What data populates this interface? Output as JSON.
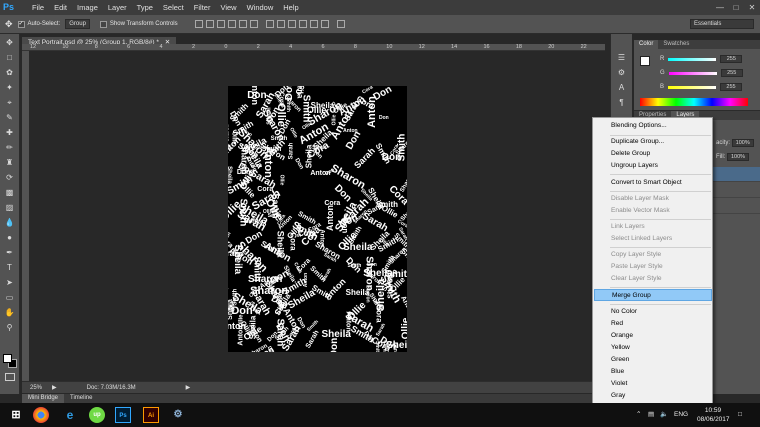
{
  "app": {
    "logo": "Ps",
    "menu": [
      "File",
      "Edit",
      "Image",
      "Layer",
      "Type",
      "Select",
      "Filter",
      "View",
      "Window",
      "Help"
    ]
  },
  "options": {
    "auto_select": "Auto-Select:",
    "auto_select_target": "Group",
    "show_transform": "Show Transform Controls",
    "workspace": "Essentials"
  },
  "document": {
    "tab_title": "Text Portrait.psd @ 25% (Group 1, RGB/8#) *",
    "ruler_ticks": [
      "12",
      "10",
      "8",
      "6",
      "4",
      "2",
      "0",
      "2",
      "4",
      "6",
      "8",
      "10",
      "12",
      "14",
      "16",
      "18",
      "20",
      "22"
    ],
    "zoom": "25%",
    "doc_size": "Doc: 7.03M/16.3M",
    "words": [
      "Cora",
      "Don",
      "Anton",
      "Sarah",
      "Ollie",
      "Sharon",
      "Sheila",
      "Smith"
    ]
  },
  "bottom_tabs": [
    "Mini Bridge",
    "Timeline"
  ],
  "color_panel": {
    "tabs": [
      "Color",
      "Swatches"
    ],
    "r_label": "R",
    "r_value": "255",
    "g_label": "G",
    "g_value": "255",
    "b_label": "B",
    "b_value": "255"
  },
  "layers_panel": {
    "tabs": [
      "Properties",
      "Layers"
    ],
    "opacity_label": "acity:",
    "opacity_value": "100%",
    "fill_label": "Fill:",
    "fill_value": "100%"
  },
  "context_menu": {
    "items": [
      {
        "label": "Blending Options...",
        "disabled": false
      },
      {
        "label": "Duplicate Group...",
        "disabled": false
      },
      {
        "label": "Delete Group",
        "disabled": false
      },
      {
        "label": "Ungroup Layers",
        "disabled": false
      },
      {
        "label": "Convert to Smart Object",
        "disabled": false
      },
      {
        "label": "Disable Layer Mask",
        "disabled": true
      },
      {
        "label": "Enable Vector Mask",
        "disabled": true
      },
      {
        "label": "Link Layers",
        "disabled": true
      },
      {
        "label": "Select Linked Layers",
        "disabled": true
      },
      {
        "label": "Copy Layer Style",
        "disabled": true
      },
      {
        "label": "Paste Layer Style",
        "disabled": true
      },
      {
        "label": "Clear Layer Style",
        "disabled": true
      },
      {
        "label": "Merge Group",
        "disabled": false,
        "highlighted": true
      },
      {
        "label": "No Color",
        "disabled": false
      },
      {
        "label": "Red",
        "disabled": false
      },
      {
        "label": "Orange",
        "disabled": false
      },
      {
        "label": "Yellow",
        "disabled": false
      },
      {
        "label": "Green",
        "disabled": false
      },
      {
        "label": "Blue",
        "disabled": false
      },
      {
        "label": "Violet",
        "disabled": false
      },
      {
        "label": "Gray",
        "disabled": false
      }
    ]
  },
  "taskbar": {
    "lang": "ENG",
    "time": "10:59",
    "date": "08/06/2017",
    "apps": [
      "Chrome",
      "Edge",
      "Upwork",
      "Photoshop",
      "Illustrator",
      "Steam"
    ]
  }
}
